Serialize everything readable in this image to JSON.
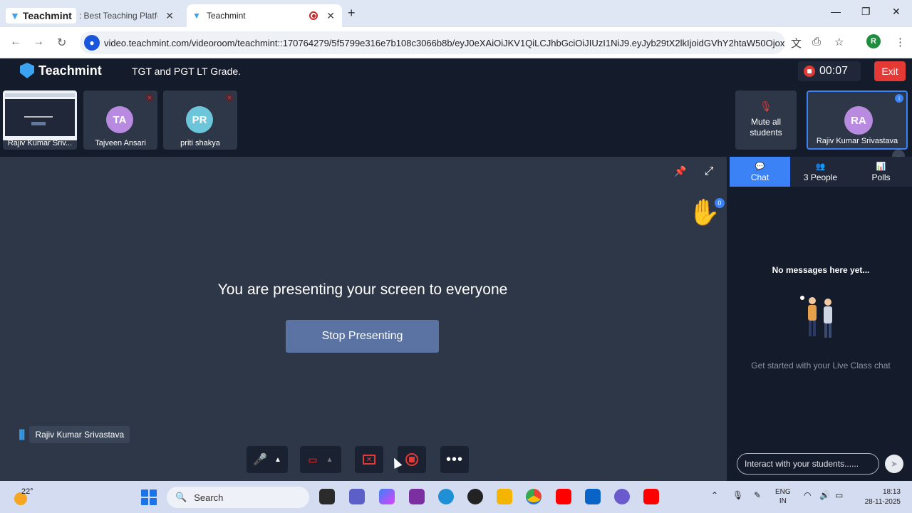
{
  "browser": {
    "tabs": [
      {
        "brand": "Teachmint",
        "label": ": Best Teaching Platfo"
      },
      {
        "label": "Teachmint"
      }
    ],
    "url": "video.teachmint.com/videoroom/teachmint::170764279/5f5799e316e7b108c3066b8b/eyJ0eXAiOiJKV1QiLCJhbGciOiJIUzI1NiJ9.eyJyb29tX2lkIjoidGVhY2htaW50Ojox...",
    "profile_initial": "R"
  },
  "app": {
    "brand": "Teachmint",
    "class_name": "TGT and PGT LT Grade.",
    "timer": "00:07",
    "exit_label": "Exit"
  },
  "participants": [
    {
      "name": "Rajiv Kumar Sriv...",
      "type": "screen"
    },
    {
      "name": "Tajveen Ansari",
      "initials": "TA",
      "color": "#b88be0"
    },
    {
      "name": "priti shakya",
      "initials": "PR",
      "color": "#6cc5d8"
    }
  ],
  "mute_all": {
    "label_line1": "Mute all",
    "label_line2": "students"
  },
  "self_tile": {
    "initials": "RA",
    "name": "Rajiv Kumar Srivastava"
  },
  "stage": {
    "message": "You are presenting your screen to everyone",
    "stop_label": "Stop Presenting",
    "hand_count": "0",
    "speaker_name": "Rajiv Kumar Srivastava"
  },
  "panel": {
    "tabs": [
      {
        "label": "Chat",
        "icon": "chat-icon"
      },
      {
        "label": "3 People",
        "icon": "people-icon"
      },
      {
        "label": "Polls",
        "icon": "polls-icon"
      }
    ],
    "empty_title": "No messages here yet...",
    "empty_sub": "Get started with your Live Class chat",
    "input_placeholder": "Interact with your students......"
  },
  "taskbar": {
    "temperature": "22°",
    "search_label": "Search",
    "lang_line1": "ENG",
    "lang_line2": "IN",
    "time": "18:13",
    "date": "28-11-2025"
  },
  "colors": {
    "accent": "#3b82f6",
    "exit": "#e53935",
    "stage_bg": "#2e3748",
    "header_bg": "#141b2a"
  }
}
